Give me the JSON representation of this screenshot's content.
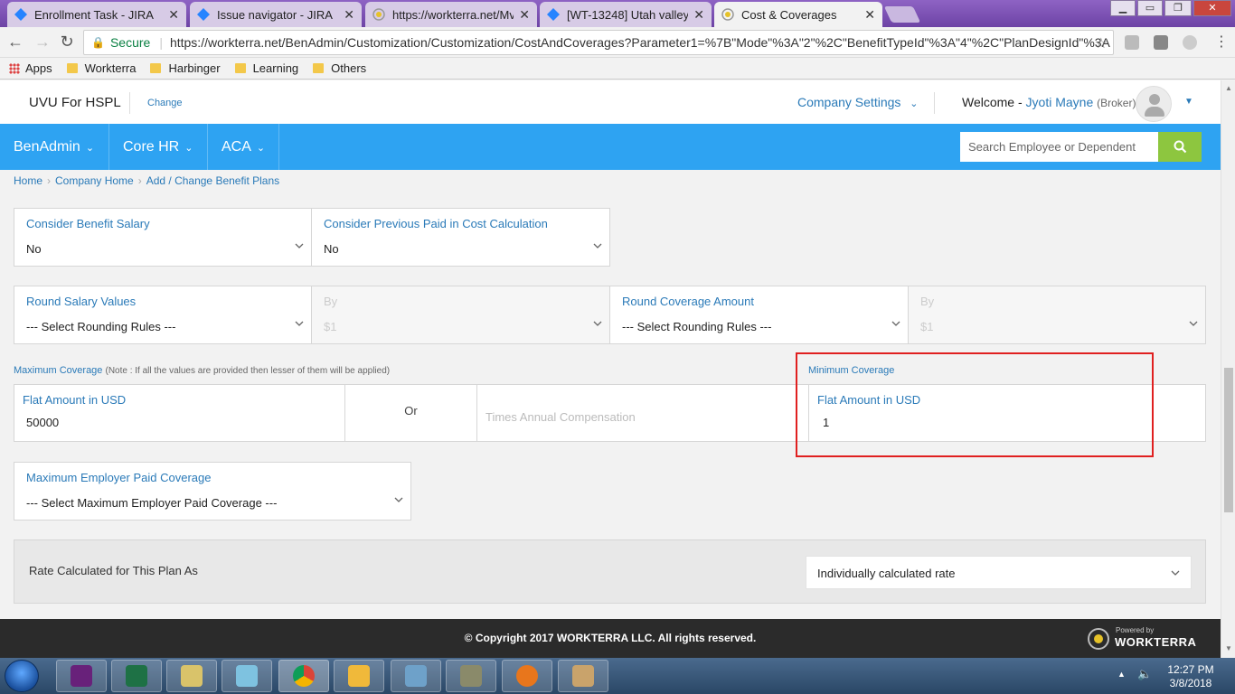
{
  "browser": {
    "tabs": [
      {
        "title": "Enrollment Task - JIRA",
        "icon": "jira-icon",
        "active": false
      },
      {
        "title": "Issue navigator - JIRA",
        "icon": "jira-icon",
        "active": false
      },
      {
        "title": "https://workterra.net/Mv",
        "icon": "workterra-icon",
        "active": false
      },
      {
        "title": "[WT-13248] Utah valley (",
        "icon": "jira-icon",
        "active": false
      },
      {
        "title": "Cost & Coverages",
        "icon": "workterra-icon",
        "active": true
      }
    ],
    "secure_label": "Secure",
    "url": "https://workterra.net/BenAdmin/Customization/Customization/CostAndCoverages?Parameter1=%7B\"Mode\"%3A\"2\"%2C\"BenefitTypeId\"%3A\"4\"%2C\"PlanDesignId\"%3A",
    "bookmarks": [
      "Apps",
      "Workterra",
      "Harbinger",
      "Learning",
      "Others"
    ]
  },
  "header": {
    "company": "UVU For HSPL",
    "change_link": "Change",
    "company_settings": "Company Settings",
    "welcome": "Welcome - ",
    "user_name": "Jyoti Mayne",
    "user_role": "(Broker)"
  },
  "nav": {
    "items": [
      "BenAdmin",
      "Core HR",
      "ACA"
    ],
    "search_placeholder": "Search Employee or Dependent"
  },
  "breadcrumb": [
    "Home",
    "Company Home",
    "Add / Change Benefit Plans"
  ],
  "form": {
    "consider_benefit_salary": {
      "label": "Consider Benefit Salary",
      "value": "No"
    },
    "consider_previous_paid": {
      "label": "Consider Previous Paid in Cost Calculation",
      "value": "No"
    },
    "round_salary_values": {
      "label": "Round Salary Values",
      "value": "--- Select Rounding Rules ---"
    },
    "round_salary_by": {
      "label": "By",
      "value": "$1"
    },
    "round_coverage_amount": {
      "label": "Round Coverage Amount",
      "value": "--- Select Rounding Rules ---"
    },
    "round_coverage_by": {
      "label": "By",
      "value": "$1"
    },
    "max_coverage": {
      "title": "Maximum Coverage",
      "note": "(Note : If all the values are provided then lesser of them will be applied)",
      "flat_label": "Flat Amount in USD",
      "flat_value": "50000",
      "or": "Or",
      "times_label": "Times Annual Compensation"
    },
    "min_coverage": {
      "title": "Minimum Coverage",
      "flat_label": "Flat Amount in USD",
      "flat_value": "1"
    },
    "max_employer_paid": {
      "label": "Maximum Employer Paid Coverage",
      "value": "--- Select Maximum Employer Paid Coverage ---"
    },
    "rate": {
      "label": "Rate Calculated for This Plan As",
      "value": "Individually calculated rate"
    }
  },
  "footer": {
    "copyright": "© Copyright 2017 WORKTERRA LLC. All rights reserved.",
    "powered_by": "Powered by",
    "brand": "WORKTERRA"
  },
  "taskbar": {
    "time": "12:27 PM",
    "date": "3/8/2018"
  },
  "colors": {
    "nav_bg": "#2ea3f2",
    "link": "#2a7ab8",
    "search_btn": "#8dc63f",
    "highlight": "#e02020",
    "footer_bg": "#2b2b2b"
  }
}
